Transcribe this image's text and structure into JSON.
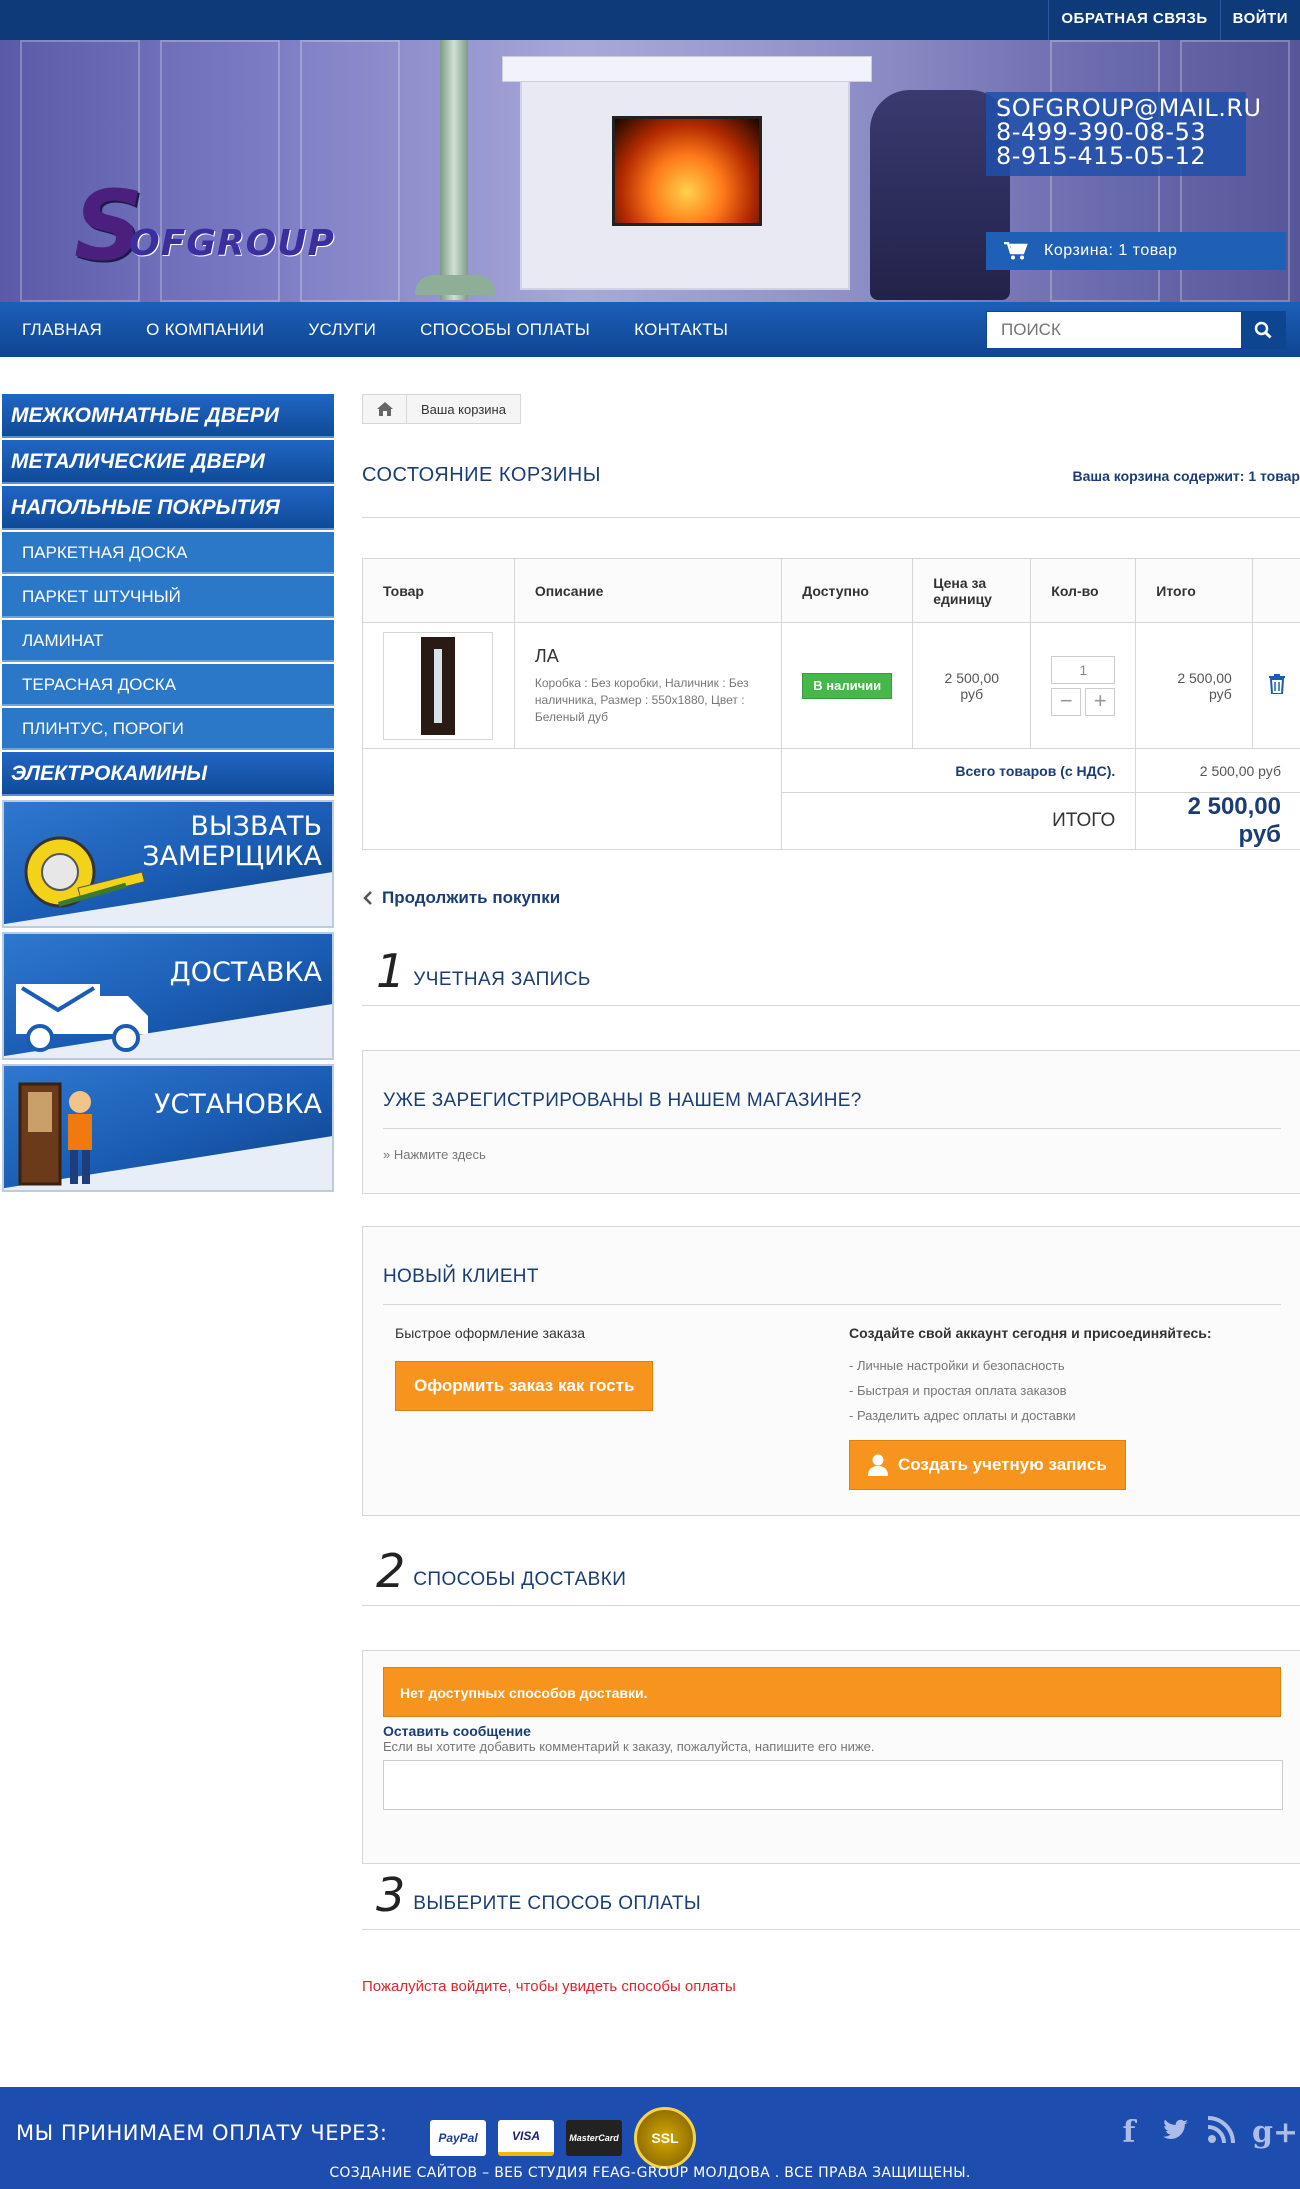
{
  "topbar": {
    "feedback": "Обратная связь",
    "login": "Войти"
  },
  "header": {
    "logo_s": "S",
    "logo_rest": "OFGROUP",
    "email": "SOFGROUP@MAIL.RU",
    "phone1": "8-499-390-08-53",
    "phone2": "8-915-415-05-12",
    "cart_label": "Корзина: 1 товар"
  },
  "nav": {
    "items": [
      "Главная",
      "О компании",
      "Услуги",
      "Способы оплаты",
      "Контакты"
    ],
    "search_placeholder": "поиск"
  },
  "sidebar": {
    "cat1": "Межкомнатные двери",
    "cat2": "Металические двери",
    "cat3": "Напольные покрытия",
    "subs": [
      "Паркетная доска",
      "Паркет штучный",
      "Ламинат",
      "Терасная доска",
      "Плинтус, пороги"
    ],
    "cat4": "Электрокамины",
    "promo1": "Вызвать\nзамерщика",
    "promo2": "Доставка",
    "promo3": "Установка"
  },
  "breadcrumb": {
    "current": "Ваша корзина"
  },
  "cart": {
    "title": "Состояние корзины",
    "count_text": "Ваша корзина содержит: 1 товар",
    "headers": [
      "Товар",
      "Описание",
      "Доступно",
      "Цена за единицу",
      "Кол-во",
      "Итого"
    ],
    "item": {
      "name": "ЛА",
      "desc": "Коробка : Без коробки, Наличник : Без наличника, Размер : 550x1880, Цвет : Беленый дуб",
      "stock": "В наличии",
      "price": "2 500,00 руб",
      "qty": "1",
      "total": "2 500,00 руб"
    },
    "sum_label": "Всего товаров (с НДС).",
    "sum_value": "2 500,00 руб",
    "total_label": "ИТОГО",
    "total_value": "2 500,00 руб",
    "continue": "Продолжить покупки"
  },
  "step1": {
    "num": "1",
    "title": "Учетная запись",
    "registered_title": "Уже зарегистрированы в нашем магазине?",
    "click_here": "» Нажмите здесь",
    "new_title": "Новый клиент",
    "quick_label": "Быстрое оформление заказа",
    "guest_button": "Оформить заказ как гость",
    "create_label": "Создайте свой аккаунт сегодня и присоединяйтесь:",
    "benefits": [
      "- Личные настройки и безопасность",
      "- Быстрая и простая оплата заказов",
      "- Разделить адрес оплаты и доставки"
    ],
    "create_button": "Создать учетную запись"
  },
  "step2": {
    "num": "2",
    "title": "Способы доставки",
    "warning": "Нет доступных способов доставки.",
    "message_label": "Оставить сообщение",
    "message_hint": "Если вы хотите добавить комментарий к заказу, пожалуйста, напишите его ниже."
  },
  "step3": {
    "num": "3",
    "title": "Выберите способ оплаты",
    "error": "Пожалуйста войдите, чтобы увидеть способы оплаты"
  },
  "footer": {
    "accept": "Мы принимаем оплату через:",
    "paypal": "PayPal",
    "visa": "VISA",
    "mastercard": "MasterCard",
    "ssl": "SSL",
    "copyright": "Создание сайтов – веб студия FEAG-Group Молдова . Все права защищены."
  },
  "colors": {
    "primary": "#0e4591",
    "accent": "#f7941d",
    "stock": "#46b84a",
    "error": "#e2232a"
  }
}
